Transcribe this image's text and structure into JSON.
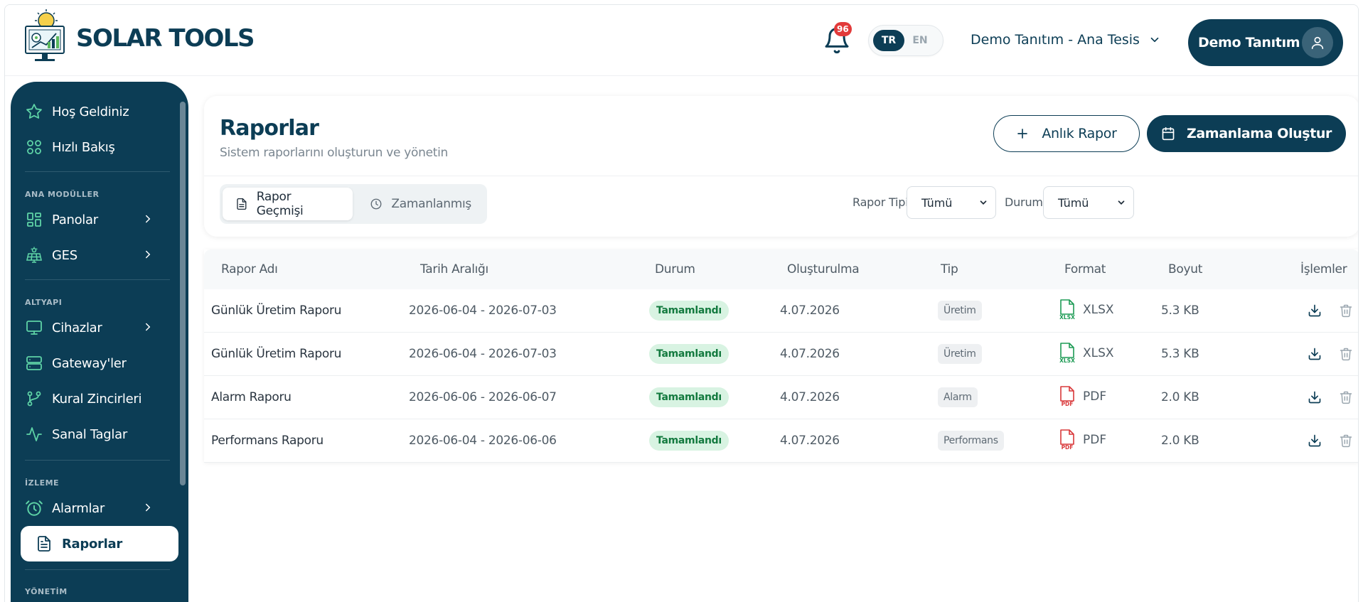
{
  "app": {
    "title": "SOLAR TOOLS"
  },
  "header": {
    "notification_count": "96",
    "languages": [
      {
        "code": "TR",
        "active": true
      },
      {
        "code": "EN",
        "active": false
      }
    ],
    "facility": "Demo Tanıtım - Ana Tesis",
    "user_name": "Demo Tanıtım"
  },
  "sidebar": {
    "items": [
      {
        "label": "Hoş Geldiniz",
        "icon": "star-icon"
      },
      {
        "label": "Hızlı Bakış",
        "icon": "grid-icon"
      }
    ],
    "sections": [
      {
        "label": "ANA MODÜLLER",
        "items": [
          {
            "label": "Panolar",
            "icon": "dashboard-icon",
            "has_children": true
          },
          {
            "label": "GES",
            "icon": "solar-panel-icon",
            "has_children": true
          }
        ]
      },
      {
        "label": "ALTYAPI",
        "items": [
          {
            "label": "Cihazlar",
            "icon": "monitor-icon",
            "has_children": true
          },
          {
            "label": "Gateway'ler",
            "icon": "server-icon",
            "has_children": false
          },
          {
            "label": "Kural Zincirleri",
            "icon": "git-branch-icon",
            "has_children": false
          },
          {
            "label": "Sanal Taglar",
            "icon": "activity-icon",
            "has_children": false
          }
        ]
      },
      {
        "label": "İZLEME",
        "items": [
          {
            "label": "Alarmlar",
            "icon": "alarm-clock-icon",
            "has_children": true
          },
          {
            "label": "Raporlar",
            "icon": "file-text-icon",
            "has_children": false,
            "active": true
          }
        ]
      },
      {
        "label": "YÖNETİM",
        "items": []
      }
    ]
  },
  "page": {
    "title": "Raporlar",
    "subtitle": "Sistem raporlarını oluşturun ve yönetin",
    "instant_report_label": "Anlık Rapor",
    "create_schedule_label": "Zamanlama Oluştur",
    "tabs": [
      {
        "label": "Rapor Geçmişi",
        "active": true
      },
      {
        "label": "Zamanlanmış",
        "active": false
      }
    ],
    "filters": {
      "report_type_label": "Rapor Tipi:",
      "report_type_value": "Tümü",
      "status_label": "Durum:",
      "status_value": "Tümü"
    }
  },
  "table": {
    "columns": [
      "Rapor Adı",
      "Tarih Aralığı",
      "Durum",
      "Oluşturulma",
      "Tip",
      "Format",
      "Boyut",
      "İşlemler"
    ],
    "rows": [
      {
        "name": "Günlük Üretim Raporu",
        "range": "2026-06-04 - 2026-07-03",
        "status": "Tamamlandı",
        "created": "4.07.2026",
        "type": "Üretim",
        "format": "XLSX",
        "format_icon": "XLSX",
        "size": "5.3 KB"
      },
      {
        "name": "Günlük Üretim Raporu",
        "range": "2026-06-04 - 2026-07-03",
        "status": "Tamamlandı",
        "created": "4.07.2026",
        "type": "Üretim",
        "format": "XLSX",
        "format_icon": "XLSX",
        "size": "5.3 KB"
      },
      {
        "name": "Alarm Raporu",
        "range": "2026-06-06 - 2026-06-07",
        "status": "Tamamlandı",
        "created": "4.07.2026",
        "type": "Alarm",
        "format": "PDF",
        "format_icon": "PDF",
        "size": "2.0 KB"
      },
      {
        "name": "Performans Raporu",
        "range": "2026-06-04 - 2026-06-06",
        "status": "Tamamlandı",
        "created": "4.07.2026",
        "type": "Performans",
        "format": "PDF",
        "format_icon": "PDF",
        "size": "2.0 KB"
      }
    ]
  },
  "colors": {
    "brand": "#0c3d55",
    "success_bg": "#d8f3e2",
    "success_text": "#137a3f",
    "xlsx": "#1d9b55",
    "pdf": "#d9383a",
    "badge": "#e23a3a"
  }
}
